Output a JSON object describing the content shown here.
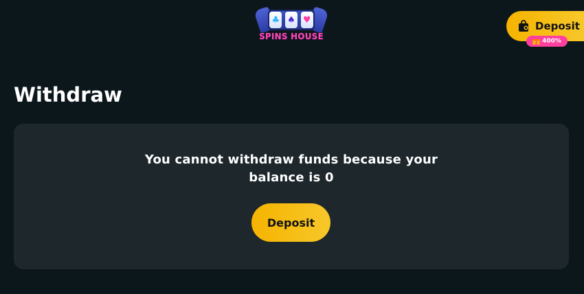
{
  "header": {
    "brand_name": "SPINS HOUSE",
    "deposit_label": "Deposit",
    "bonus_badge": "400%",
    "icons": {
      "deposit": "shopping-bag-icon",
      "bonus": "gift-icon"
    },
    "logo_symbols": [
      "♣",
      "♠",
      "♥"
    ]
  },
  "page": {
    "title": "Withdraw"
  },
  "card": {
    "message": "You cannot withdraw funds because your balance is 0",
    "deposit_label": "Deposit"
  },
  "colors": {
    "background": "#0c171c",
    "card": "#1d272c",
    "accent_yellow": "#f5b400",
    "badge_pink": "#ff3f9f",
    "brand_pink": "#ff49b6"
  }
}
